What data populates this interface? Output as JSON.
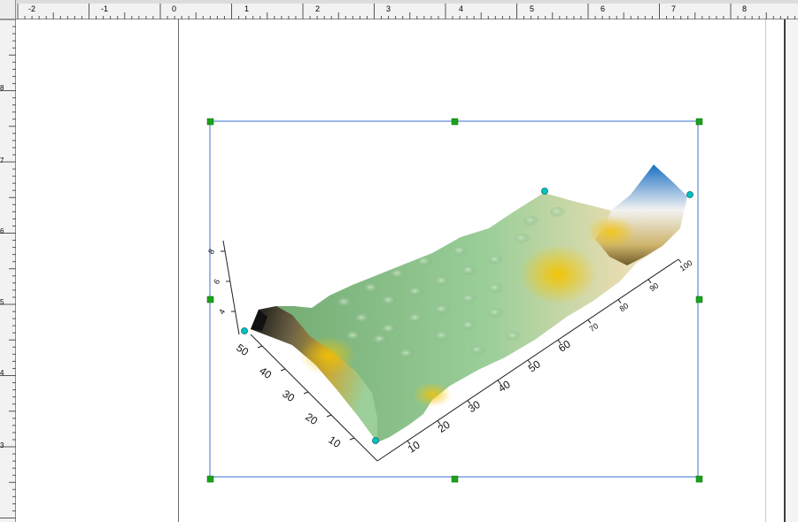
{
  "ruler": {
    "top_labels": [
      "-2",
      "-1",
      "0",
      "1",
      "2",
      "3",
      "4",
      "5",
      "6",
      "7",
      "8"
    ],
    "left_labels": [
      "8",
      "7",
      "6",
      "5",
      "4",
      "3"
    ]
  },
  "chart_data": {
    "type": "surface",
    "x_ticks": [
      "10",
      "20",
      "30",
      "40",
      "50",
      "60",
      "70",
      "80",
      "90",
      "100"
    ],
    "y_ticks": [
      "10",
      "20",
      "30",
      "40",
      "50"
    ],
    "z_ticks": [
      "8",
      "6",
      "4"
    ],
    "x_range": [
      0,
      100
    ],
    "y_range": [
      0,
      55
    ],
    "colormap": [
      "#1a6fc4",
      "#ffffff",
      "#f5c400",
      "#2b2b2b",
      "#9ccf9a",
      "#7fbf7f"
    ],
    "grid": false
  },
  "selection": {
    "frame_color": "#3a6fd0",
    "handle_color": "#1aa31a",
    "vertex_color": "#00c2c2"
  }
}
